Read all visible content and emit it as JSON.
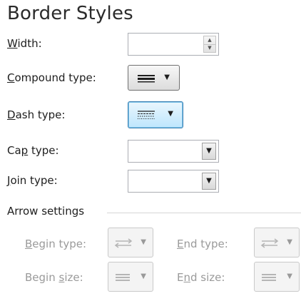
{
  "panel": {
    "title": "Border Styles"
  },
  "width": {
    "label_mn": "W",
    "label_rest": "idth:",
    "value": "",
    "up_icon": "▲",
    "down_icon": "▼"
  },
  "compound": {
    "label_mn": "C",
    "label_rest": "ompound type:",
    "arrow": "▼"
  },
  "dash": {
    "label_mn": "D",
    "label_rest": "ash type:",
    "arrow": "▼"
  },
  "cap": {
    "label_pre": "Ca",
    "label_mn": "p",
    "label_rest": " type:",
    "value": "",
    "arrow": "▼"
  },
  "join": {
    "label_mn": "J",
    "label_rest": "oin type:",
    "value": "",
    "arrow": "▼"
  },
  "arrow_settings": {
    "title": "Arrow settings",
    "begin_type": {
      "label_mn": "B",
      "label_rest": "egin type:",
      "arrow": "▼"
    },
    "end_type": {
      "label_mn": "E",
      "label_rest": "nd type:",
      "arrow": "▼"
    },
    "begin_size": {
      "label_pre": "Begin ",
      "label_mn": "s",
      "label_rest": "ize:",
      "arrow": "▼"
    },
    "end_size": {
      "label_pre": "E",
      "label_mn": "n",
      "label_rest": "d size:",
      "arrow": "▼"
    }
  },
  "colors": {
    "focus_border": "#3c7fb1",
    "disabled_text": "#9a9a9a"
  }
}
